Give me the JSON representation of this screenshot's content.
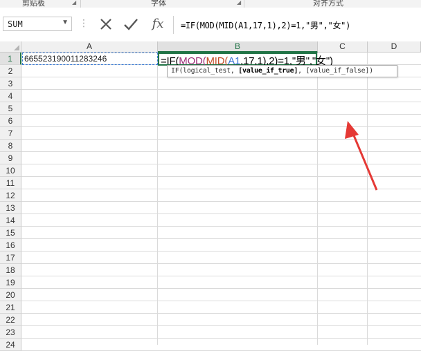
{
  "ribbon": {
    "groups": [
      "剪贴板",
      "字体",
      "对齐方式"
    ]
  },
  "formula_bar": {
    "name_box": "SUM",
    "cancel_icon": "close-icon",
    "enter_icon": "check-icon",
    "fx_label": "fx",
    "formula": "=IF(MOD(MID(A1,17,1),2)=1,\"男\",\"女\")"
  },
  "sheet": {
    "columns": [
      "A",
      "B",
      "C",
      "D"
    ],
    "selected_column": "B",
    "rows": [
      "1",
      "2",
      "3",
      "4",
      "5",
      "6",
      "7",
      "8",
      "9",
      "10",
      "11",
      "12",
      "13",
      "14",
      "15",
      "16",
      "17",
      "18",
      "19",
      "20",
      "21",
      "22",
      "23",
      "24"
    ],
    "selected_row": "1",
    "cells": {
      "A1": "665523190011283246",
      "B1_parts": {
        "p0": "=IF(",
        "p1": "MOD(",
        "p2": "MID(",
        "ref": "A1",
        "p3": ",17,1),2)=1,\"男\",\"女\")"
      }
    }
  },
  "tooltip": {
    "fn": "IF(",
    "arg1": "logical_test",
    "sep1": ", ",
    "arg2": "[value_if_true]",
    "sep2": ", ",
    "arg3": "[value_if_false]",
    "close": ")"
  },
  "colors": {
    "accent": "#217346",
    "reference": "#3b73d4",
    "annotation_arrow": "#e53935"
  }
}
